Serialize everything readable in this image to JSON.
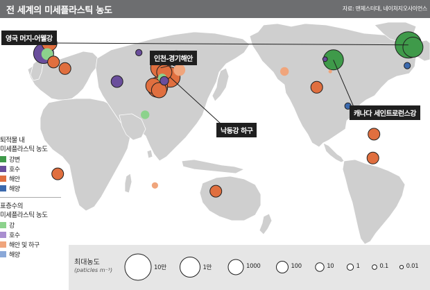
{
  "header": {
    "title": "전 세계의 미세플라스틱 농도",
    "source": "자료: 맨체스터대, 네이처지오사이언스"
  },
  "colors": {
    "river_bed": "#3f9a4a",
    "lake_bed": "#6a4e9c",
    "coast_bed": "#e06f3f",
    "ocean_bed": "#3b69ad",
    "river_surface": "#8cd28c",
    "lake_surface": "#a98ed0",
    "coast_surface": "#f0a57c",
    "ocean_surface": "#8aa8d8",
    "land": "#cfcfcf",
    "sea": "#ffffff"
  },
  "callouts": [
    {
      "id": "mersey",
      "label": "영국 머지-어웰강"
    },
    {
      "id": "incheon",
      "label": "인천-경기해안"
    },
    {
      "id": "nakdong",
      "label": "낙동강 하구"
    },
    {
      "id": "stlawrence",
      "label": "캐나다 세인트로런스강"
    }
  ],
  "legend": {
    "sediment_title_line1": "퇴적물 내",
    "sediment_title_line2": "미세플라스틱 농도",
    "sediment_items": [
      {
        "label": "강변",
        "color_key": "river_bed"
      },
      {
        "label": "호수",
        "color_key": "lake_bed"
      },
      {
        "label": "해안",
        "color_key": "coast_bed"
      },
      {
        "label": "해양",
        "color_key": "ocean_bed"
      }
    ],
    "surface_title_line1": "표층수의",
    "surface_title_line2": "미세플라스틱 농도",
    "surface_items": [
      {
        "label": "강",
        "color_key": "river_surface"
      },
      {
        "label": "호수",
        "color_key": "lake_surface"
      },
      {
        "label": "해안 및 하구",
        "color_key": "coast_surface"
      },
      {
        "label": "해양",
        "color_key": "ocean_surface"
      }
    ]
  },
  "size_legend": {
    "title": "최대농도",
    "unit": "(paticles m⁻³)",
    "steps": [
      "10만",
      "1만",
      "1000",
      "100",
      "10",
      "1",
      "0.1",
      "0.01"
    ]
  },
  "points": [
    {
      "name": "uk-mersey",
      "type": "river_bed",
      "value": "100000",
      "lon": -2.9,
      "lat": 53.4
    },
    {
      "name": "uk-north",
      "type": "river_bed",
      "value": "10000",
      "lon": 1.5,
      "lat": 51.8
    },
    {
      "name": "europe-lake",
      "type": "lake_bed",
      "value": "10000",
      "lon": 6.5,
      "lat": 47.5
    },
    {
      "name": "europe-coast-north",
      "type": "coast_bed",
      "value": "1000",
      "lon": 12.0,
      "lat": 54.5
    },
    {
      "name": "europe-river-surface",
      "type": "river_surface",
      "value": "100",
      "lon": 10.0,
      "lat": 47.0
    },
    {
      "name": "mediterranean-coast",
      "type": "coast_bed",
      "value": "100",
      "lon": 16.0,
      "lat": 41.5
    },
    {
      "name": "mediterranean-east",
      "type": "coast_bed",
      "value": "100",
      "lon": 27.0,
      "lat": 37.0
    },
    {
      "name": "iberia-ocean",
      "type": "ocean_bed",
      "value": "1",
      "lon": -4.0,
      "lat": 39.0
    },
    {
      "name": "india-lake",
      "type": "lake_bed",
      "value": "100",
      "lon": 77.0,
      "lat": 28.0
    },
    {
      "name": "mongolia-lake",
      "type": "lake_bed",
      "value": "1",
      "lon": 98.0,
      "lat": 48.0
    },
    {
      "name": "sea-of-japan-ocean",
      "type": "ocean_bed",
      "value": "1000",
      "lon": 134.0,
      "lat": 44.0
    },
    {
      "name": "japan-coast-surface",
      "type": "coast_surface",
      "value": "100",
      "lon": 137.0,
      "lat": 36.0
    },
    {
      "name": "korea-incheon",
      "type": "coast_bed",
      "value": "10000",
      "lon": 119.0,
      "lat": 37.5
    },
    {
      "name": "korea-nakdong",
      "type": "coast_bed",
      "value": "10000",
      "lon": 128.0,
      "lat": 31.0
    },
    {
      "name": "yellow-sea-coast",
      "type": "coast_bed",
      "value": "1000",
      "lon": 122.5,
      "lat": 34.5
    },
    {
      "name": "china-river-surface",
      "type": "river_surface",
      "value": "10",
      "lon": 120.5,
      "lat": 30.5
    },
    {
      "name": "china-lake",
      "type": "lake_bed",
      "value": "10",
      "lon": 122.5,
      "lat": 28.5
    },
    {
      "name": "china-coast-1",
      "type": "coast_bed",
      "value": "10000",
      "lon": 116.0,
      "lat": 24.0
    },
    {
      "name": "china-coast-2",
      "type": "coast_bed",
      "value": "1000",
      "lon": 112.0,
      "lat": 25.0
    },
    {
      "name": "china-coast-3",
      "type": "coast_bed",
      "value": "1000",
      "lon": 117.5,
      "lat": 22.0
    },
    {
      "name": "se-asia-river-surface",
      "type": "river_surface",
      "value": "10",
      "lon": 104.0,
      "lat": 5.0
    },
    {
      "name": "australia-coast-surface",
      "type": "coast_surface",
      "value": "1",
      "lon": 113.5,
      "lat": -44.0
    },
    {
      "name": "new-zealand-coast",
      "type": "coast_bed",
      "value": "100",
      "lon": 172.0,
      "lat": -48.0
    },
    {
      "name": "south-africa-coast",
      "type": "coast_bed",
      "value": "100",
      "lon": 20.0,
      "lat": -36.0
    },
    {
      "name": "canada-st-lawrence",
      "type": "river_bed",
      "value": "10000",
      "lon": -75.0,
      "lat": 43.0
    },
    {
      "name": "great-lakes",
      "type": "lake_bed",
      "value": "0.1",
      "lon": -83.0,
      "lat": 43.5
    },
    {
      "name": "us-east-coast-surface",
      "type": "coast_surface",
      "value": "0.01",
      "lon": -78.0,
      "lat": 35.0
    },
    {
      "name": "california-coast-surface",
      "type": "coast_surface",
      "value": "10",
      "lon": -122.0,
      "lat": 35.0
    },
    {
      "name": "gulf-of-mexico-coast",
      "type": "coast_bed",
      "value": "100",
      "lon": -91.0,
      "lat": 24.0
    },
    {
      "name": "atlantic-ocean",
      "type": "ocean_bed",
      "value": "1",
      "lon": -61.0,
      "lat": 11.0
    },
    {
      "name": "brazil-coast",
      "type": "coast_bed",
      "value": "100",
      "lon": -36.0,
      "lat": -8.5
    },
    {
      "name": "argentina-coast",
      "type": "coast_bed",
      "value": "100",
      "lon": -37.0,
      "lat": -25.0
    }
  ]
}
